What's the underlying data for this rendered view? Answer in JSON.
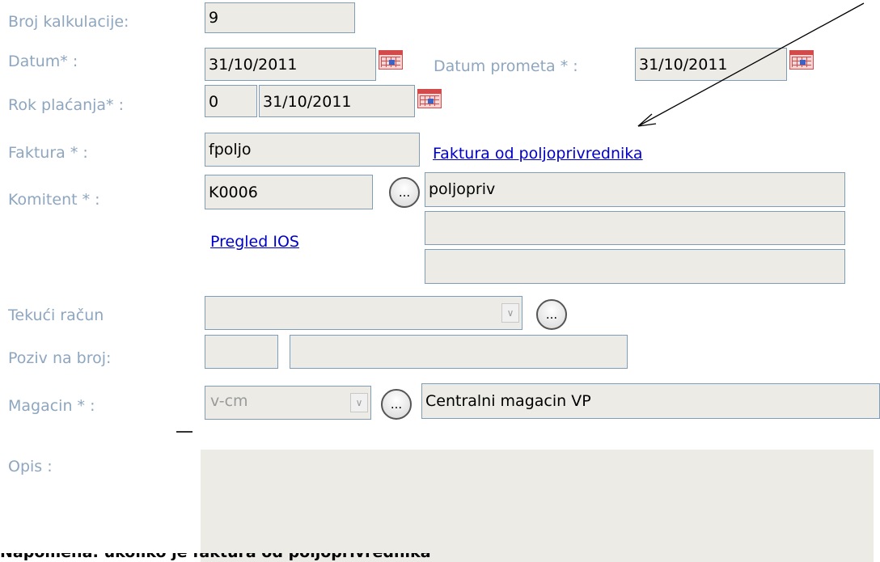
{
  "form": {
    "broj_kalkulacije": {
      "label": "Broj kalkulacije:",
      "value": "9"
    },
    "datum": {
      "label": "Datum* :",
      "value": "31/10/2011"
    },
    "datum_prometa": {
      "label": "Datum prometa * :",
      "value": "31/10/2011"
    },
    "rok_placanja": {
      "label": "Rok plaćanja* :",
      "days": "0",
      "date": "31/10/2011"
    },
    "faktura": {
      "label": "Faktura * :",
      "value": "fpoljo",
      "link": "Faktura od poljoprivrednika"
    },
    "komitent": {
      "label": "Komitent * :",
      "code": "K0006",
      "ellipsis": "...",
      "name": "poljopriv",
      "line2": "",
      "line3": "",
      "link": "Pregled IOS"
    },
    "tekuci_racun": {
      "label": "Tekući račun",
      "value": "",
      "ellipsis": "..."
    },
    "poziv_na_broj": {
      "label": "Poziv na broj:",
      "model": "",
      "number": ""
    },
    "magacin": {
      "label": "Magacin * :",
      "code": "v-cm",
      "ellipsis": "...",
      "name": "Centralni magacin VP"
    },
    "opis": {
      "label": "Opis :",
      "value": ""
    }
  },
  "annotation": {
    "type": "arrow",
    "points_to": "Faktura od poljoprivrednika"
  },
  "bottom_text": "Napomena: ukoliko je faktura od poljoprivrednika"
}
